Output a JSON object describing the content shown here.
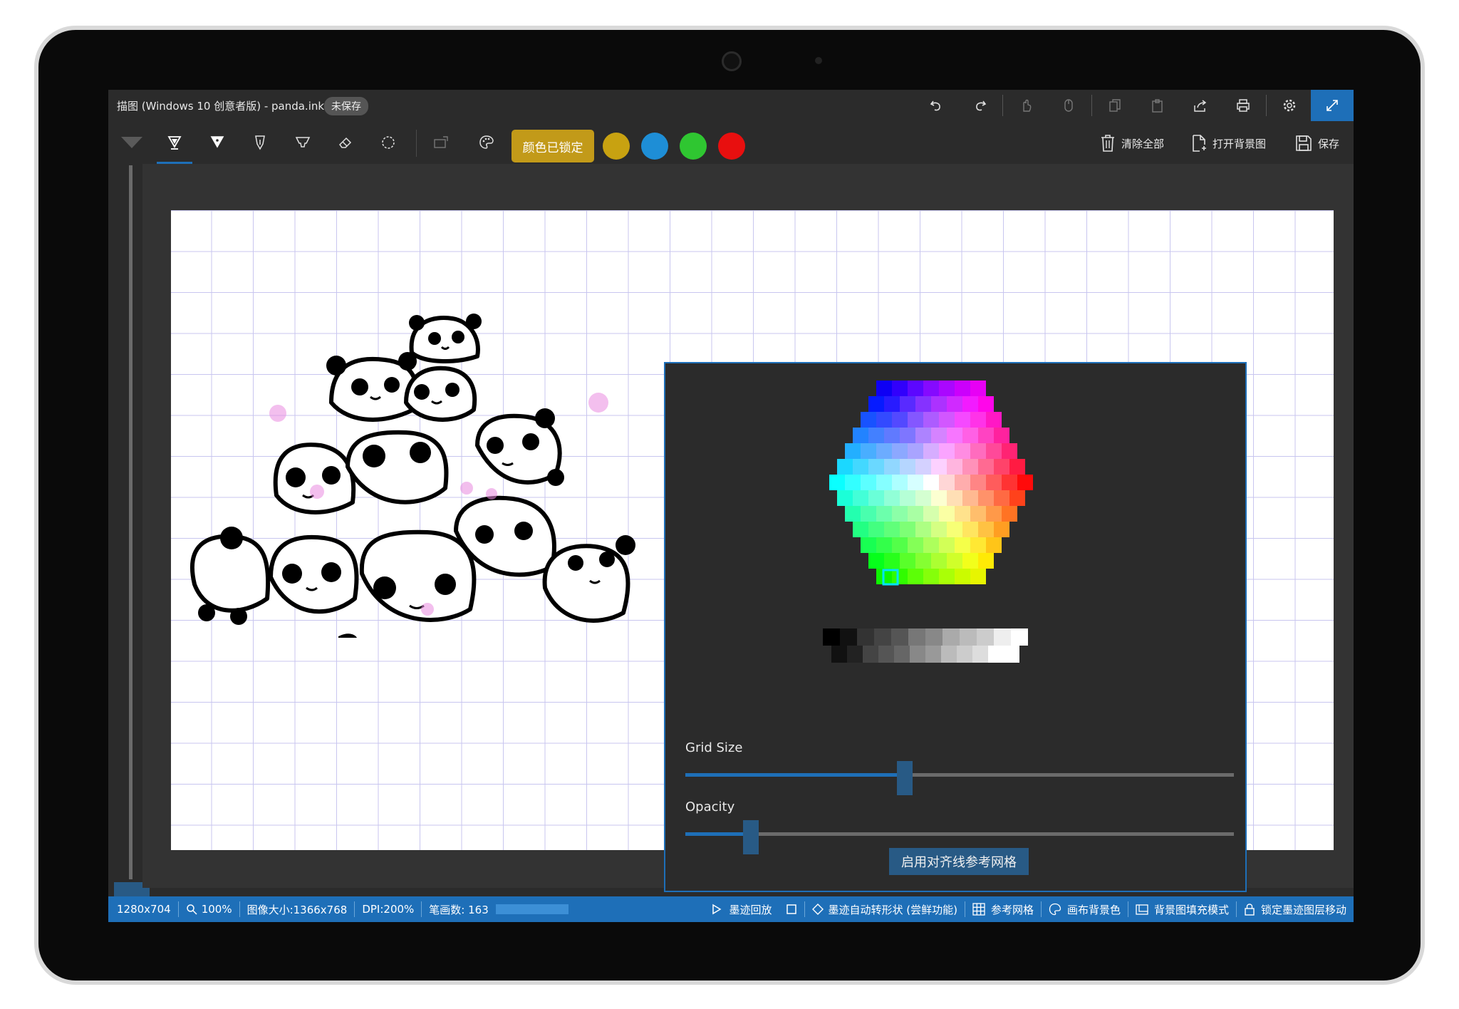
{
  "app": {
    "title": "描图 (Windows 10 创意者版) - panda.ink",
    "status_badge": "未保存"
  },
  "toolbar": {
    "color_lock_label": "颜色已锁定",
    "swatches": [
      "#c8a211",
      "#1e8ed6",
      "#2fc631",
      "#e80f0f"
    ],
    "clear_all_label": "清除全部",
    "open_background_label": "打开背景图",
    "save_label": "保存"
  },
  "picker": {
    "grid_size_label": "Grid Size",
    "grid_size_value": 0.4,
    "opacity_label": "Opacity",
    "opacity_value": 0.12,
    "enable_grid_button": "启用对齐线参考网格"
  },
  "statusbar": {
    "canvas_size": "1280x704",
    "zoom": "100%",
    "image_size": "图像大小:1366x768",
    "dpi": "DPI:200%",
    "stroke_count": "笔画数: 163",
    "playback": "墨迹回放",
    "auto_shape": "墨迹自动转形状 (尝鲜功能)",
    "reference_grid": "参考网格",
    "canvas_bg_color": "画布背景色",
    "bg_fill_mode": "背景图填充模式",
    "lock_layer": "锁定墨迹图层移动"
  },
  "colors": {
    "accent": "#1e6fb8",
    "lock": "#c29a19"
  }
}
